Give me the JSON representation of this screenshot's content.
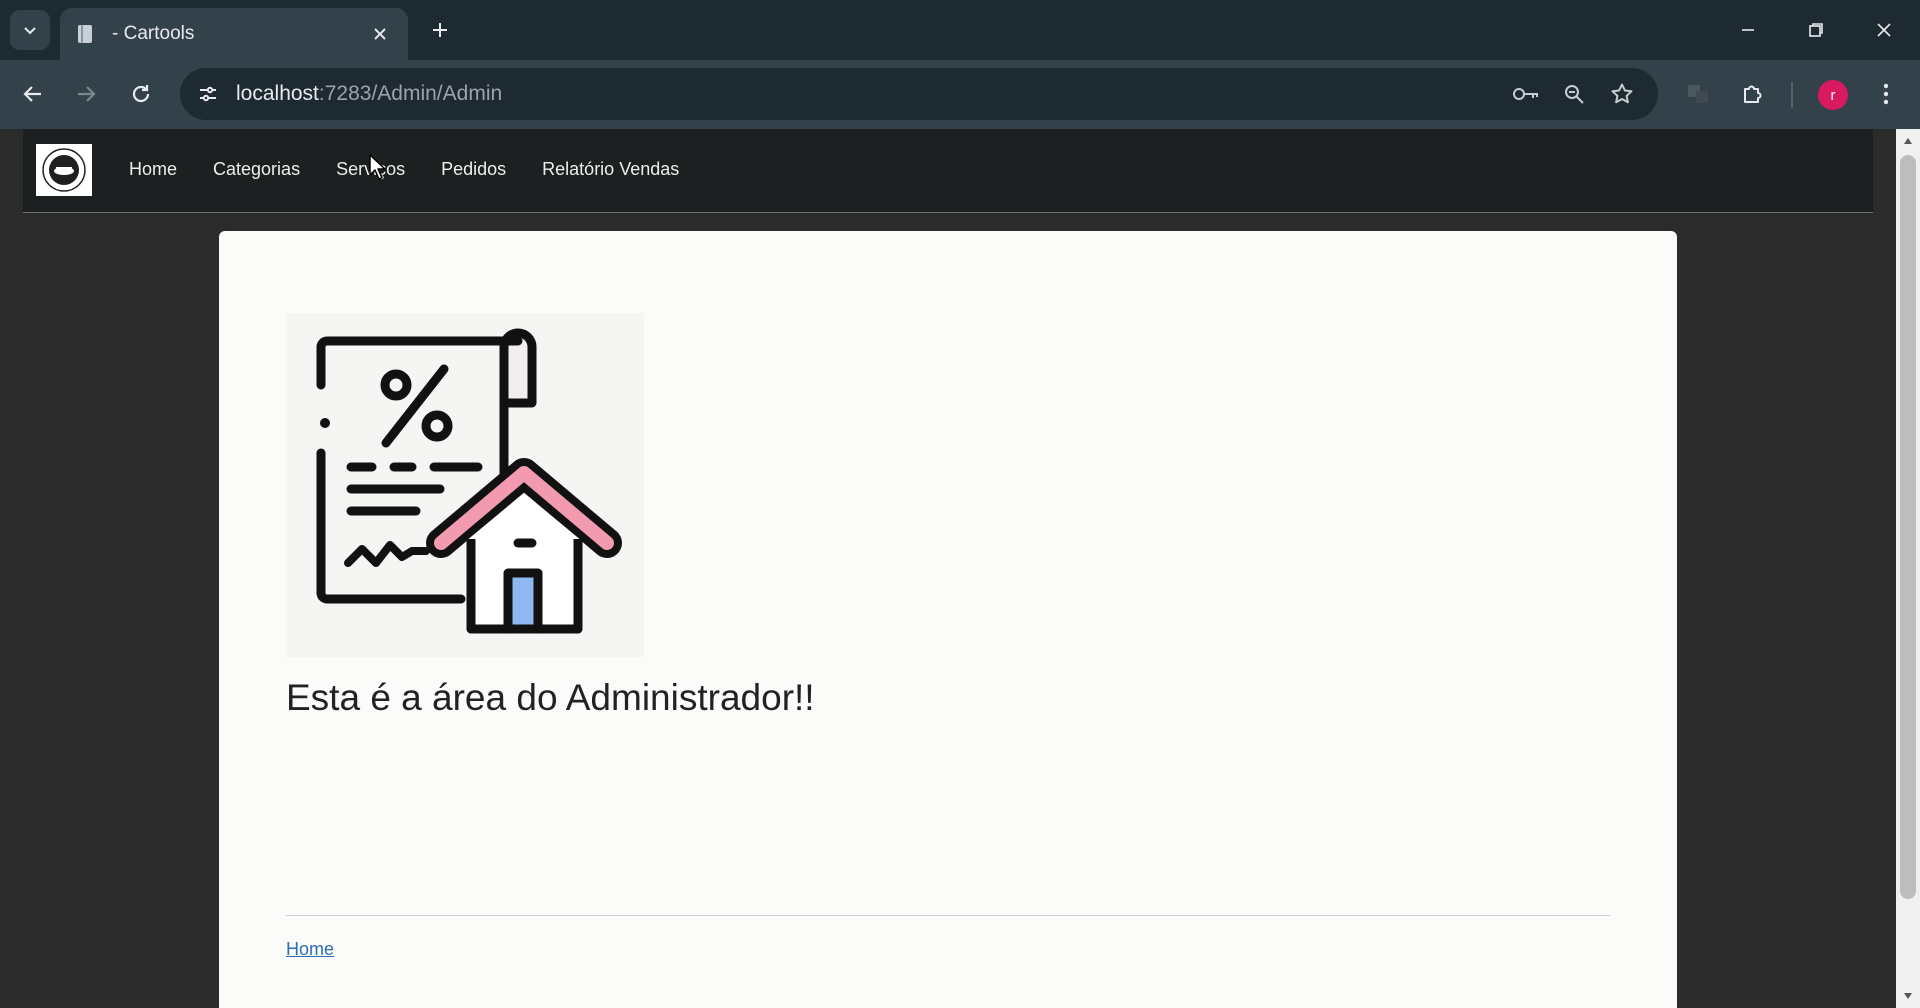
{
  "browser": {
    "tab": {
      "title": " - Cartools"
    },
    "url": {
      "host": "localhost",
      "path": ":7283/Admin/Admin"
    },
    "profile_initial": "r"
  },
  "page": {
    "nav": {
      "items": [
        {
          "label": "Home"
        },
        {
          "label": "Categorias"
        },
        {
          "label": "Serviços"
        },
        {
          "label": "Pedidos"
        },
        {
          "label": "Relatório Vendas"
        }
      ]
    },
    "heading": "Esta é a área do Administrador!!",
    "footer_link": "Home",
    "hero_icon": "tax-document-house-icon",
    "colors": {
      "roof": "#f29bb0",
      "door": "#8fb8f3",
      "avatar": "#d81b60",
      "link": "#2d6cb5"
    }
  }
}
